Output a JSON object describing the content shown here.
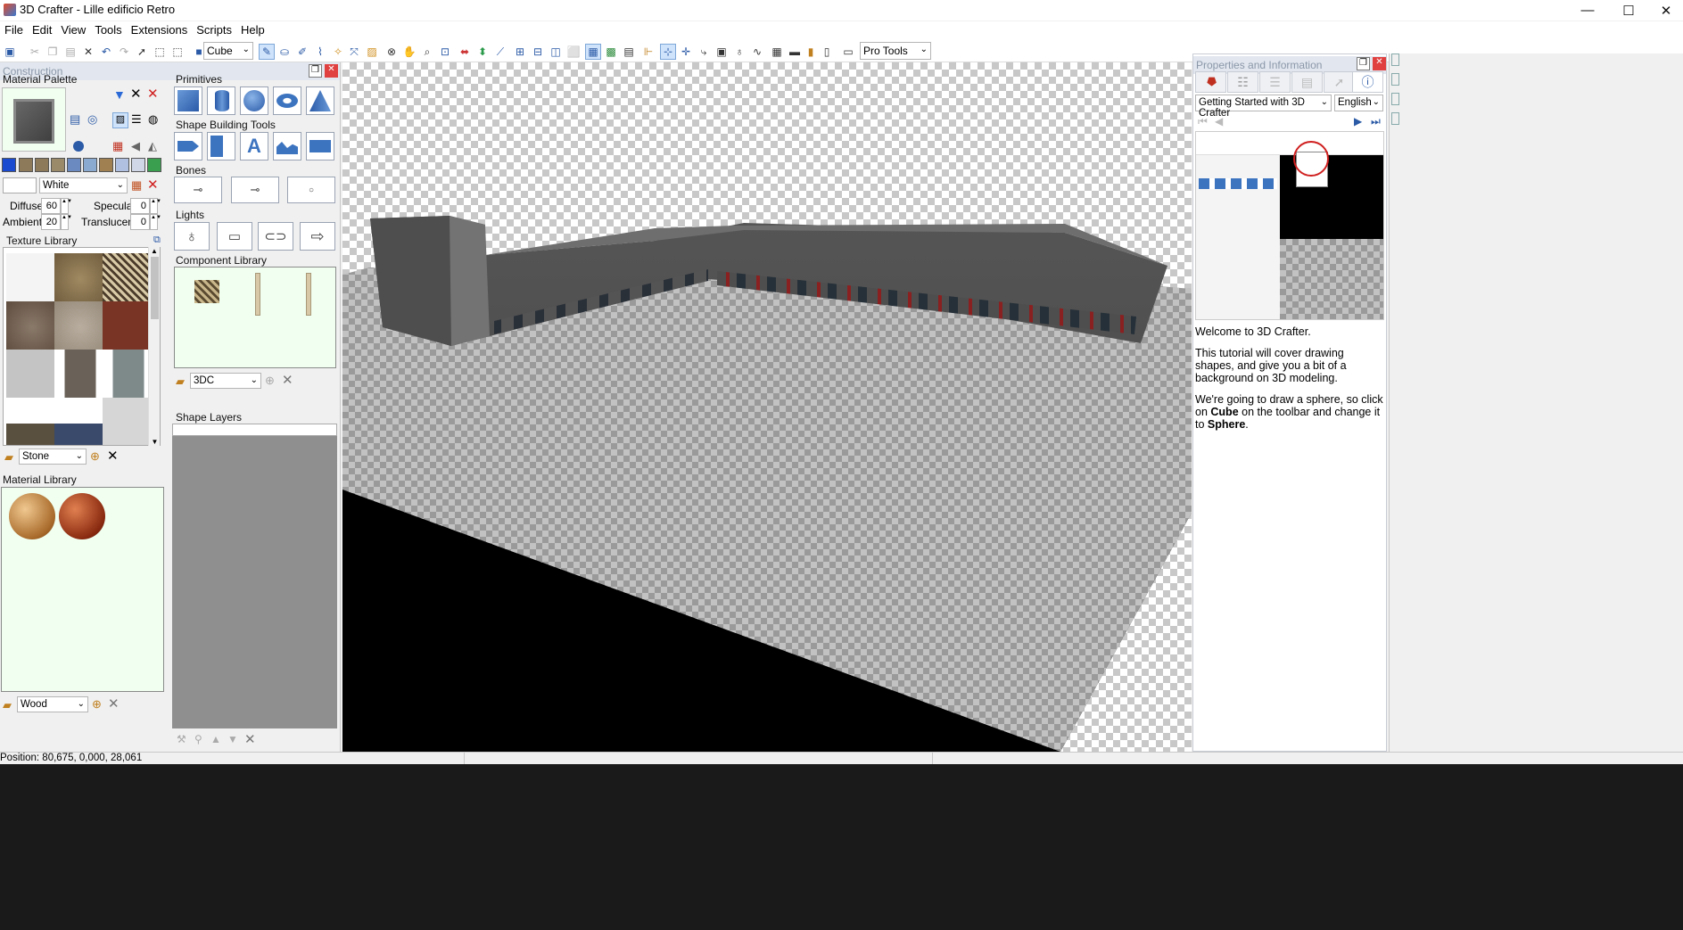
{
  "app": {
    "title": "3D Crafter - Lille edificio Retro"
  },
  "window_controls": {
    "minimize": "—",
    "maximize": "☐",
    "close": "✕"
  },
  "menu": [
    "File",
    "Edit",
    "View",
    "Tools",
    "Extensions",
    "Scripts",
    "Help"
  ],
  "toolbar": {
    "shape_select": "Cube",
    "mode_select": "Pro Tools"
  },
  "construction": {
    "title": "Construction",
    "material_palette": {
      "label": "Material Palette",
      "color_name": "White",
      "diffuse_label": "Diffuse",
      "diffuse": "60",
      "specular_label": "Specular",
      "specular": "0",
      "ambient_label": "Ambient",
      "ambient": "20",
      "translucent_label": "Translucent",
      "translucent": "0"
    },
    "texture_library": {
      "label": "Texture Library",
      "category": "Stone"
    },
    "material_library": {
      "label": "Material Library",
      "category": "Wood"
    },
    "primitives_label": "Primitives",
    "shape_building_label": "Shape Building Tools",
    "bones_label": "Bones",
    "lights_label": "Lights",
    "component_library": {
      "label": "Component Library",
      "category": "3DC"
    },
    "shape_layers_label": "Shape Layers"
  },
  "properties": {
    "title": "Properties and Information",
    "tutorial_select": "Getting Started with 3D Crafter",
    "language": "English",
    "tutorial_text": {
      "p1": "Welcome to 3D Crafter.",
      "p2": "This tutorial will cover drawing shapes, and give you a bit of a background on 3D modeling.",
      "p3_a": "We're going to draw a sphere, so click on ",
      "p3_b": "Cube",
      "p3_c": " on the toolbar and change it to ",
      "p3_d": "Sphere",
      "p3_e": "."
    }
  },
  "status": {
    "position": "Position: 80,675, 0,000, 28,061"
  },
  "colors": {
    "accent": "#3d74c0",
    "library_bg": "#f0fff0",
    "panel_header": "#e2e7ef"
  }
}
